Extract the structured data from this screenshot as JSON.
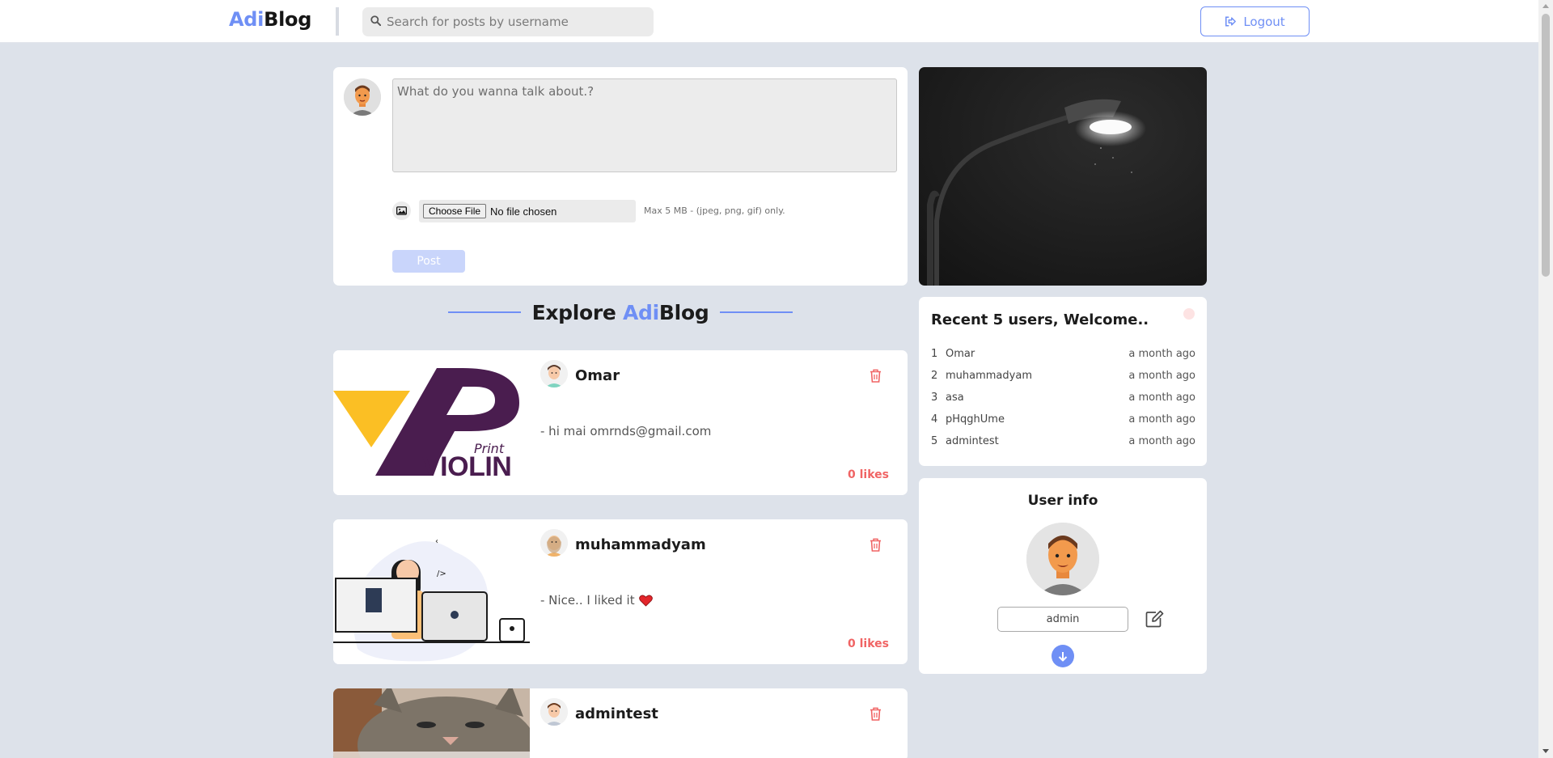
{
  "nav": {
    "logo_accent": "Adi",
    "logo_rest": "Blog",
    "search_placeholder": "Search for posts by username",
    "logout_label": "Logout"
  },
  "composer": {
    "placeholder": "What do you wanna talk about.?",
    "choose_file_label": "Choose File",
    "file_status": "No file chosen",
    "file_hint": "Max 5 MB - (jpeg, png, gif) only.",
    "post_label": "Post"
  },
  "explore": {
    "prefix": "Explore ",
    "accent": "Adi",
    "rest": "Blog"
  },
  "posts": [
    {
      "author": "Omar",
      "content": "- hi mai omrnds@gmail.com",
      "likes": "0 likes",
      "thumb_brand": "Print",
      "thumb_title": "VIOLIN"
    },
    {
      "author": "muhammadyam",
      "content": "- Nice.. I liked it",
      "likes": "0 likes",
      "emoji": "heart-icon"
    },
    {
      "author": "admintest"
    }
  ],
  "recent_users": {
    "title": "Recent 5 users, Welcome..",
    "items": [
      {
        "num": "1",
        "name": "Omar",
        "time": "a month ago"
      },
      {
        "num": "2",
        "name": "muhammadyam",
        "time": "a month ago"
      },
      {
        "num": "3",
        "name": "asa",
        "time": "a month ago"
      },
      {
        "num": "4",
        "name": "pHqghUme",
        "time": "a month ago"
      },
      {
        "num": "5",
        "name": "admintest",
        "time": "a month ago"
      }
    ]
  },
  "user_info": {
    "title": "User info",
    "username": "admin"
  },
  "colors": {
    "accent": "#6f8ff5",
    "likes": "#f06464",
    "background": "#dde2ea"
  }
}
